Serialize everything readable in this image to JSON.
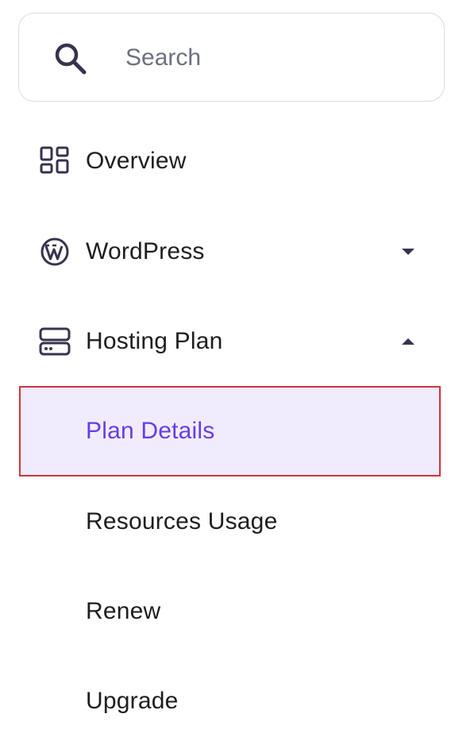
{
  "search": {
    "placeholder": "Search",
    "icon": "search-icon"
  },
  "nav": {
    "overview": {
      "label": "Overview",
      "icon": "grid-icon"
    },
    "wordpress": {
      "label": "WordPress",
      "icon": "wordpress-icon",
      "expanded": false
    },
    "hosting_plan": {
      "label": "Hosting Plan",
      "icon": "server-icon",
      "expanded": true
    }
  },
  "hosting_sub": [
    {
      "label": "Plan Details",
      "active": true
    },
    {
      "label": "Resources Usage",
      "active": false
    },
    {
      "label": "Renew",
      "active": false
    },
    {
      "label": "Upgrade",
      "active": false
    }
  ],
  "colors": {
    "text": "#1d1e20",
    "active_text": "#673de6",
    "active_bg": "#f1ecfd",
    "highlight_border": "#d1333d",
    "icon": "#36344d",
    "placeholder": "#6d7081"
  }
}
